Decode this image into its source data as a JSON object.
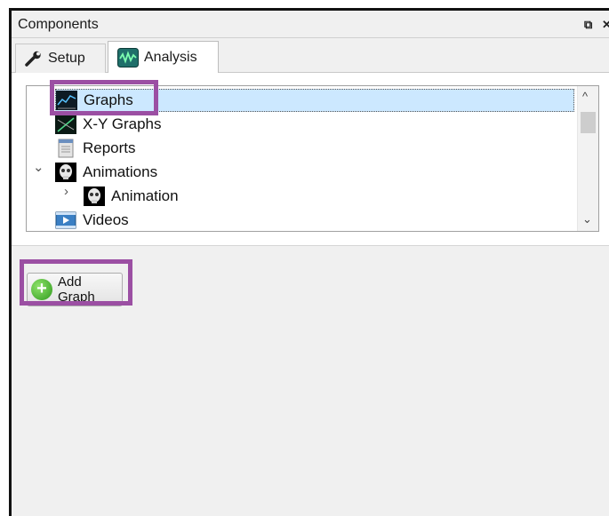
{
  "panel": {
    "title": "Components",
    "float_icon": "⧉",
    "close_icon": "✕"
  },
  "tabs": [
    {
      "label": "Setup",
      "icon": "wrench-icon",
      "active": false
    },
    {
      "label": "Analysis",
      "icon": "waveform-icon",
      "active": true
    }
  ],
  "tree": {
    "items": [
      {
        "label": "Graphs",
        "icon": "graph-icon",
        "selected": true
      },
      {
        "label": "X-Y Graphs",
        "icon": "xy-graph-icon",
        "selected": false
      },
      {
        "label": "Reports",
        "icon": "report-icon",
        "selected": false
      },
      {
        "label": "Animations",
        "icon": "skull-icon",
        "expanded": true
      },
      {
        "label": "Animation",
        "icon": "skull-icon",
        "expanded": false
      },
      {
        "label": "Videos",
        "icon": "video-icon",
        "selected": false
      }
    ],
    "expanded_glyph": "⌄",
    "collapsed_glyph": "›"
  },
  "scrollbar": {
    "up": "^",
    "down": "⌄"
  },
  "add_graph_button": {
    "label": "Add Graph"
  },
  "colors": {
    "highlight": "#9b4fa3",
    "selection": "#cce8ff"
  }
}
